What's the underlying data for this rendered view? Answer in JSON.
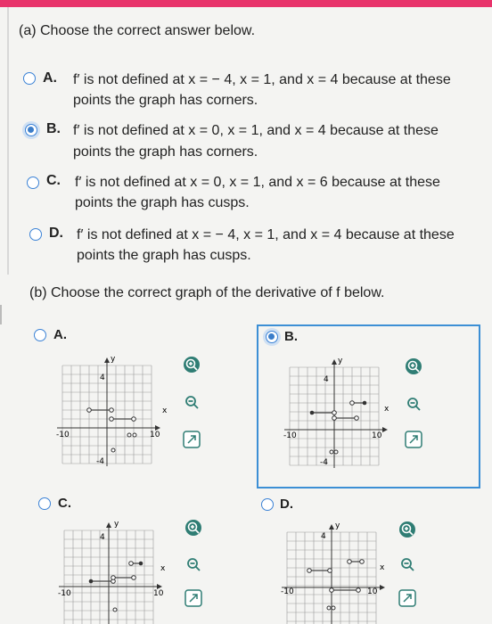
{
  "part_a": {
    "heading": "(a) Choose the correct answer below.",
    "options": [
      {
        "letter": "A.",
        "line1": "f′ is not defined at x = − 4, x = 1, and x = 4 because at these",
        "line2": "points the graph has corners.",
        "selected": false
      },
      {
        "letter": "B.",
        "line1": "f′ is not defined at x = 0, x = 1, and x = 4 because at these",
        "line2": "points the graph has corners.",
        "selected": true
      },
      {
        "letter": "C.",
        "line1": "f′ is not defined at x = 0, x = 1, and x = 6 because at these",
        "line2": "points the graph has cusps.",
        "selected": false
      },
      {
        "letter": "D.",
        "line1": "f′ is not defined at x = − 4, x = 1, and x = 4 because at these",
        "line2": "points the graph has cusps.",
        "selected": false
      }
    ]
  },
  "part_b": {
    "heading": "(b) Choose the correct graph of the derivative of f below.",
    "options": [
      {
        "letter": "A.",
        "selected": false
      },
      {
        "letter": "B.",
        "selected": true
      },
      {
        "letter": "C.",
        "selected": false
      },
      {
        "letter": "D.",
        "selected": false
      }
    ],
    "graph_labels": {
      "y": "y",
      "x": "x",
      "ymax": "4",
      "xmin": "-10",
      "xmax": "10",
      "ymin": "-4"
    }
  },
  "icons": {
    "zoom_in": "zoom-in-icon",
    "zoom_out": "zoom-out-icon",
    "popout": "popout-icon"
  },
  "colors": {
    "accent": "#3b7dc9",
    "top_bar": "#e8336b",
    "selected_border": "#3c8fd5"
  }
}
